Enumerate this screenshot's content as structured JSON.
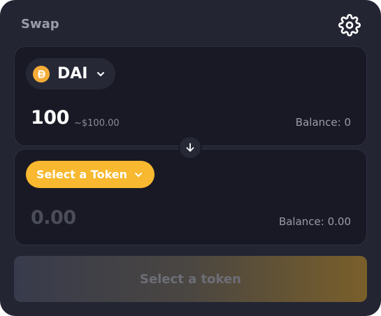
{
  "header": {
    "title": "Swap",
    "settings_icon": "gear-icon"
  },
  "from": {
    "token_symbol": "DAI",
    "token_logo": "dai-logo-icon",
    "amount": "100",
    "usd_value": "~$100.00",
    "balance": "Balance: 0"
  },
  "direction_icon": "arrow-down-icon",
  "to": {
    "select_label": "Select a Token",
    "amount_placeholder": "0.00",
    "balance": "Balance: 0.00"
  },
  "action": {
    "label": "Select a token"
  },
  "colors": {
    "card_bg": "#232533",
    "panel_bg": "#181924",
    "accent_yellow": "#f8b82f",
    "dai_logo": "#f5ac37"
  }
}
